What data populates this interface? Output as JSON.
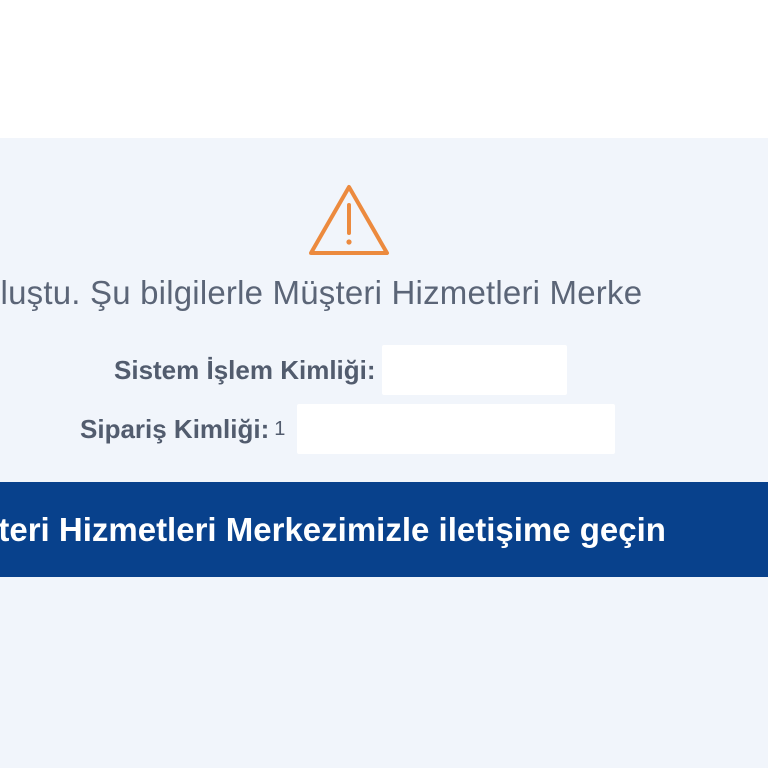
{
  "icon": {
    "name": "warning-triangle-icon",
    "color": "#ec8a3e"
  },
  "message": {
    "text": "oluştu. Şu bilgilerle Müşteri Hizmetleri Merke"
  },
  "system_transaction": {
    "label": "Sistem İşlem Kimliği:"
  },
  "order": {
    "label": "Sipariş Kimliği:",
    "partial_char": "1"
  },
  "contact_banner": {
    "text": "steri Hizmetleri Merkezimizle iletişime geçin",
    "color": "#08418c"
  }
}
